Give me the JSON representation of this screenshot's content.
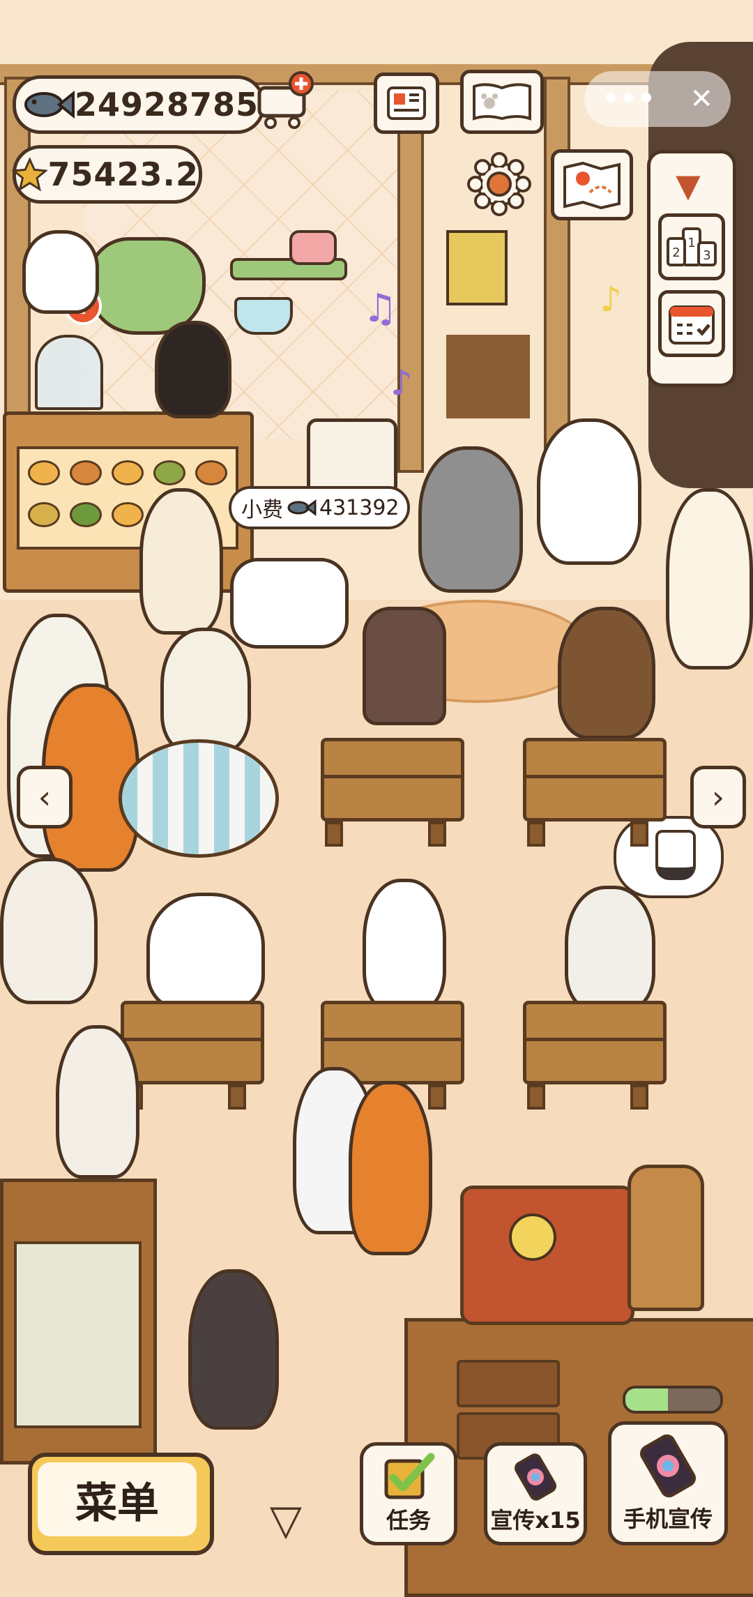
{
  "hud": {
    "fish_currency": "24928785",
    "star_currency": "75423.2",
    "fish_icon": "fish-icon",
    "star_icon": "star-icon"
  },
  "mini_program": {
    "more_icon": "•••",
    "close_icon": "✕"
  },
  "tip_bubble": {
    "label": "小费",
    "amount": "431392"
  },
  "side_panel": {
    "collapse_icon": "▼",
    "rank_icon": "rank-icon",
    "calendar_icon": "calendar-icon"
  },
  "bottom_bar": {
    "menu_label": "菜单",
    "tasks_label": "任务",
    "promo_label": "宣传x15",
    "phone_promo_label": "手机宣传",
    "collapse_arrow": "▽"
  },
  "nav": {
    "left_arrow": "‹",
    "right_arrow": "›"
  },
  "progress": {
    "value": 0.45
  },
  "colors": {
    "outline": "#4a3322",
    "panel": "#fdf6ec",
    "accent_yellow": "#f4c95a",
    "progress_green": "#a7e08b"
  }
}
